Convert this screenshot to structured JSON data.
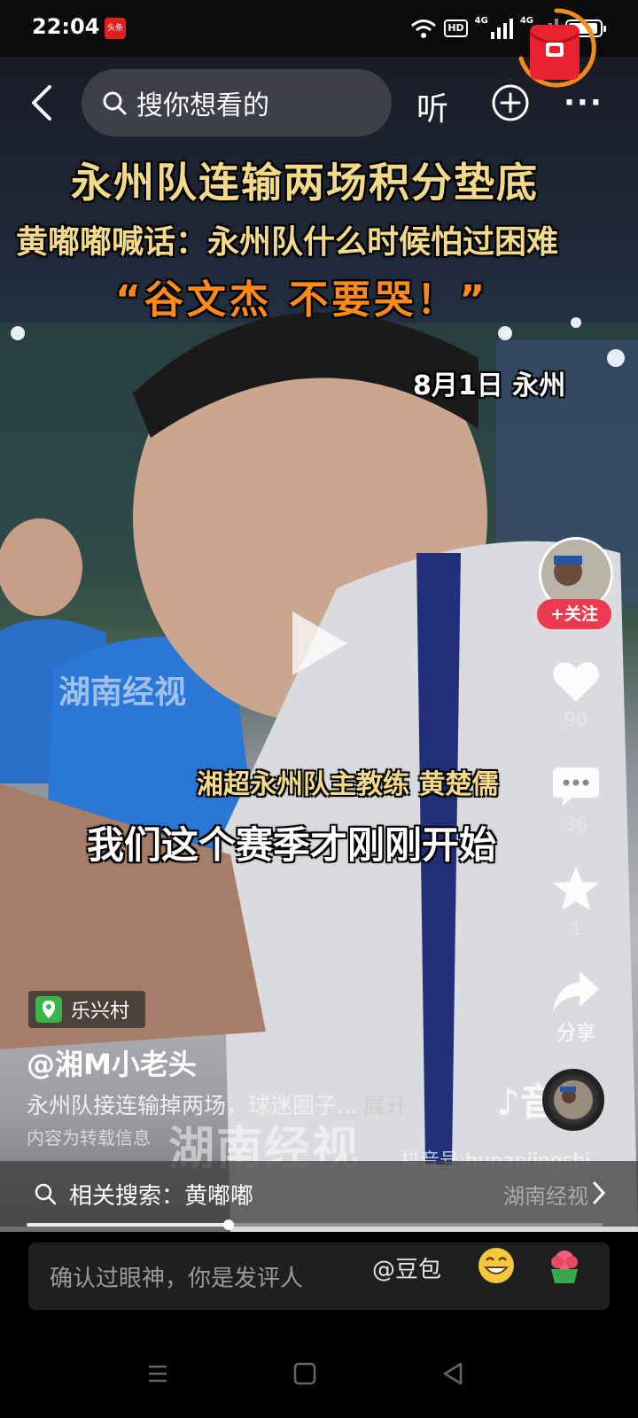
{
  "status_bar": {
    "time": "22:04",
    "app_badge": "头条",
    "hd_label": "HD",
    "signal_1_label": "4G",
    "signal_2_label": "4G",
    "battery_level": 0.95
  },
  "top_nav": {
    "search_placeholder": "搜你想看的",
    "listen_label": "听",
    "more_label": "···"
  },
  "video": {
    "headline_1": "永州队连输两场积分垫底",
    "headline_2": "黄嘟嘟喊话：永州队什么时候怕过困难",
    "headline_3": "“谷文杰 不要哭！”",
    "date_location": "8月1日 永州",
    "speaker_caption": "湘超永州队主教练 黄楚儒",
    "subtitle": "我们这个赛季才刚刚开始",
    "watermark": "湖南经视",
    "watermark_bottom": "湖南经视",
    "douyin_id": "抖音号:hunanjingshi",
    "douyin_mark": "♪音"
  },
  "actions": {
    "follow_label": "+关注",
    "like_count": "90",
    "comment_count": "36",
    "favorite_count": "1",
    "share_label": "分享"
  },
  "info": {
    "location": "乐兴村",
    "author": "@湘M小老头",
    "description": "永州队接连输掉两场，球迷圈子...",
    "expand_label": "展开",
    "repost_note": "内容为转载信息",
    "related_search": "相关搜索：黄嘟嘟",
    "related_search_right": "湖南经视"
  },
  "progress": {
    "fraction": 0.35
  },
  "comment_bar": {
    "placeholder": "确认过眼神，你是发评人",
    "mention": "@豆包"
  },
  "colors": {
    "follow": "#ec3a4f",
    "caption_gold": "#f3d98a",
    "caption_orange": "#ff8a1a"
  }
}
